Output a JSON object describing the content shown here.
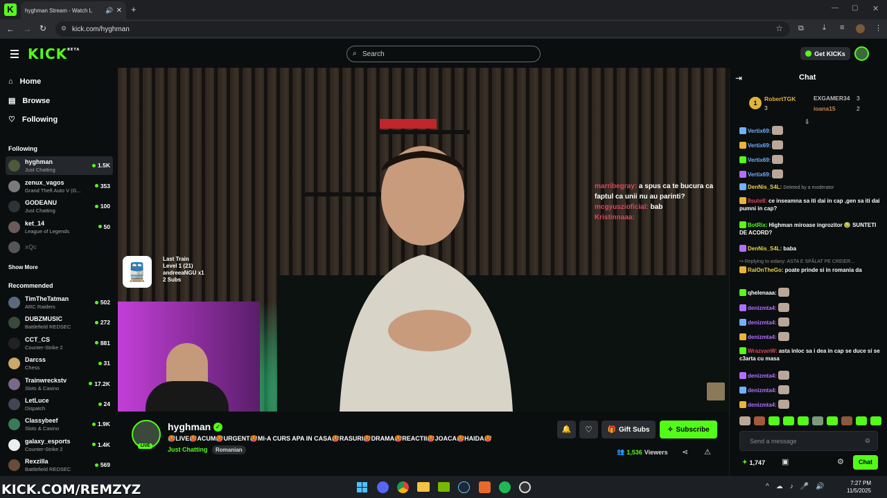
{
  "browser": {
    "tab_title": "hyghman Stream - Watch L",
    "url": "kick.com/hyghman"
  },
  "site": {
    "logo": "KICK",
    "logo_tag": "BETA",
    "search_placeholder": "Search",
    "get_kicks": "Get KICKs"
  },
  "sidebar": {
    "nav": [
      {
        "label": "Home",
        "icon": "home-icon"
      },
      {
        "label": "Browse",
        "icon": "browse-icon"
      },
      {
        "label": "Following",
        "icon": "heart-icon"
      }
    ],
    "following_title": "Following",
    "following": [
      {
        "name": "hyghman",
        "game": "Just Chatting",
        "viewers": "1.5K",
        "color": "#4a5a3a"
      },
      {
        "name": "zenux_vagos",
        "game": "Grand Theft Auto V (G...",
        "viewers": "353",
        "color": "#7a7a7a"
      },
      {
        "name": "GODEANU",
        "game": "Just Chatting",
        "viewers": "100",
        "color": "#2f3338"
      },
      {
        "name": "ket_14",
        "game": "League of Legends",
        "viewers": "50",
        "color": "#6a5a5a"
      },
      {
        "name": "xQc",
        "game": "",
        "viewers": "",
        "color": "#555"
      }
    ],
    "show_more": "Show More",
    "recommended_title": "Recommended",
    "recommended": [
      {
        "name": "TimTheTatman",
        "game": "ARC Raiders",
        "viewers": "502",
        "color": "#5a6a7a"
      },
      {
        "name": "DUBZMUSIC",
        "game": "Battlefield REDSEC",
        "viewers": "272",
        "color": "#3a4a3a"
      },
      {
        "name": "CCT_CS",
        "game": "Counter-Strike 2",
        "viewers": "881",
        "color": "#222"
      },
      {
        "name": "Darcss",
        "game": "Chess",
        "viewers": "31",
        "color": "#c9a96a"
      },
      {
        "name": "Trainwreckstv",
        "game": "Slots & Casino",
        "viewers": "17.2K",
        "color": "#7a6a8a"
      },
      {
        "name": "LetLuce",
        "game": "Dispatch",
        "viewers": "24",
        "color": "#445"
      },
      {
        "name": "Classybeef",
        "game": "Slots & Casino",
        "viewers": "1.9K",
        "color": "#3a7a5a"
      },
      {
        "name": "galaxy_esports",
        "game": "Counter-Strike 2",
        "viewers": "1.4K",
        "color": "#eee"
      },
      {
        "name": "Rexzilla",
        "game": "Battlefield REDSEC",
        "viewers": "569",
        "color": "#6a4a3a"
      }
    ]
  },
  "video": {
    "overlay_lines": [
      "Last Train",
      "Level 1  (21)",
      "andreeaNGU x1",
      "2 Subs"
    ],
    "stream_chat": [
      {
        "user": "marribegray:",
        "text": "a spus ca te bucura ca faptul ca unii nu au parinti?"
      },
      {
        "user": "mcgyuszioficial:",
        "text": "bab"
      },
      {
        "user": "Kristinnaaa:",
        "text": ""
      }
    ]
  },
  "stream": {
    "streamer": "hyghman",
    "live_badge": "LIVE",
    "title": "🥵LIVE🥵ACUM🥵URGENT🥵MI-A CURS APA IN CASA🥵RASURI🥵DRAMA🥵REACTII🥵JOACA🥵HAIDA🥵",
    "category": "Just Chatting",
    "language": "Romanian",
    "viewers": "1,536",
    "viewers_label": "Viewers",
    "gift_subs": "Gift Subs",
    "subscribe": "Subscribe"
  },
  "chat": {
    "title": "Chat",
    "leaderboard": {
      "first": {
        "rank": "1",
        "name": "RobertTGK",
        "count": "3"
      },
      "second": {
        "name": "EXGAMER34",
        "count": "3"
      },
      "third": {
        "name": "ioana15",
        "count": "2"
      }
    },
    "messages": [
      {
        "user": "Vertix69:",
        "text": "",
        "color": "#6fb0ff"
      },
      {
        "user": "Vertix69:",
        "text": "",
        "color": "#6fb0ff"
      },
      {
        "user": "Vertix69:",
        "text": "",
        "color": "#6fb0ff"
      },
      {
        "user": "Vertix69:",
        "text": "",
        "color": "#6fb0ff"
      },
      {
        "user": "DenNis_S4L:",
        "text": "Deleted by a moderator",
        "color": "#e8d34a"
      },
      {
        "user": "8sute8:",
        "text": "ce inseamna sa iti dai in cap ,gen sa iti dai pumni in cap?",
        "color": "#e0455b"
      },
      {
        "user": "BotRix:",
        "text": "Highman miroase ingrozitor 🤢 SUNTETI DE ACORD?",
        "color": "#53fc18"
      },
      {
        "user": "DenNis_S4L:",
        "text": "baba",
        "color": "#e8d34a"
      },
      {
        "reply": "Replying to wdany: ASTA E SPĂLAT PE CREIER..."
      },
      {
        "user": "RaiOnTheGo:",
        "text": "poate prinde si in romania da",
        "color": "#e8d34a"
      },
      {
        "user": "qhelenaaa:",
        "text": "",
        "color": "#ffffff"
      },
      {
        "user": "denizmta4:",
        "text": "",
        "color": "#b070ff"
      },
      {
        "user": "denizmta4:",
        "text": "",
        "color": "#b070ff"
      },
      {
        "user": "denizmta4:",
        "text": "",
        "color": "#b070ff"
      },
      {
        "user": "WrazvanW:",
        "text": "asta inloc sa i dea in cap se duce si se c3arta cu masa",
        "color": "#e0455b"
      },
      {
        "user": "denizmta4:",
        "text": "",
        "color": "#b070ff"
      },
      {
        "user": "denizmta4:",
        "text": "",
        "color": "#b070ff"
      },
      {
        "user": "denizmta4:",
        "text": "",
        "color": "#b070ff"
      }
    ],
    "input_placeholder": "Send a message",
    "points": "1,747",
    "send": "Chat"
  },
  "watermark": "KICK.COM/REMZYZ",
  "taskbar": {
    "time": "7:27 PM",
    "date": "11/5/2025"
  },
  "colors": {
    "accent": "#53fc18",
    "background": "#0b0e0f"
  }
}
